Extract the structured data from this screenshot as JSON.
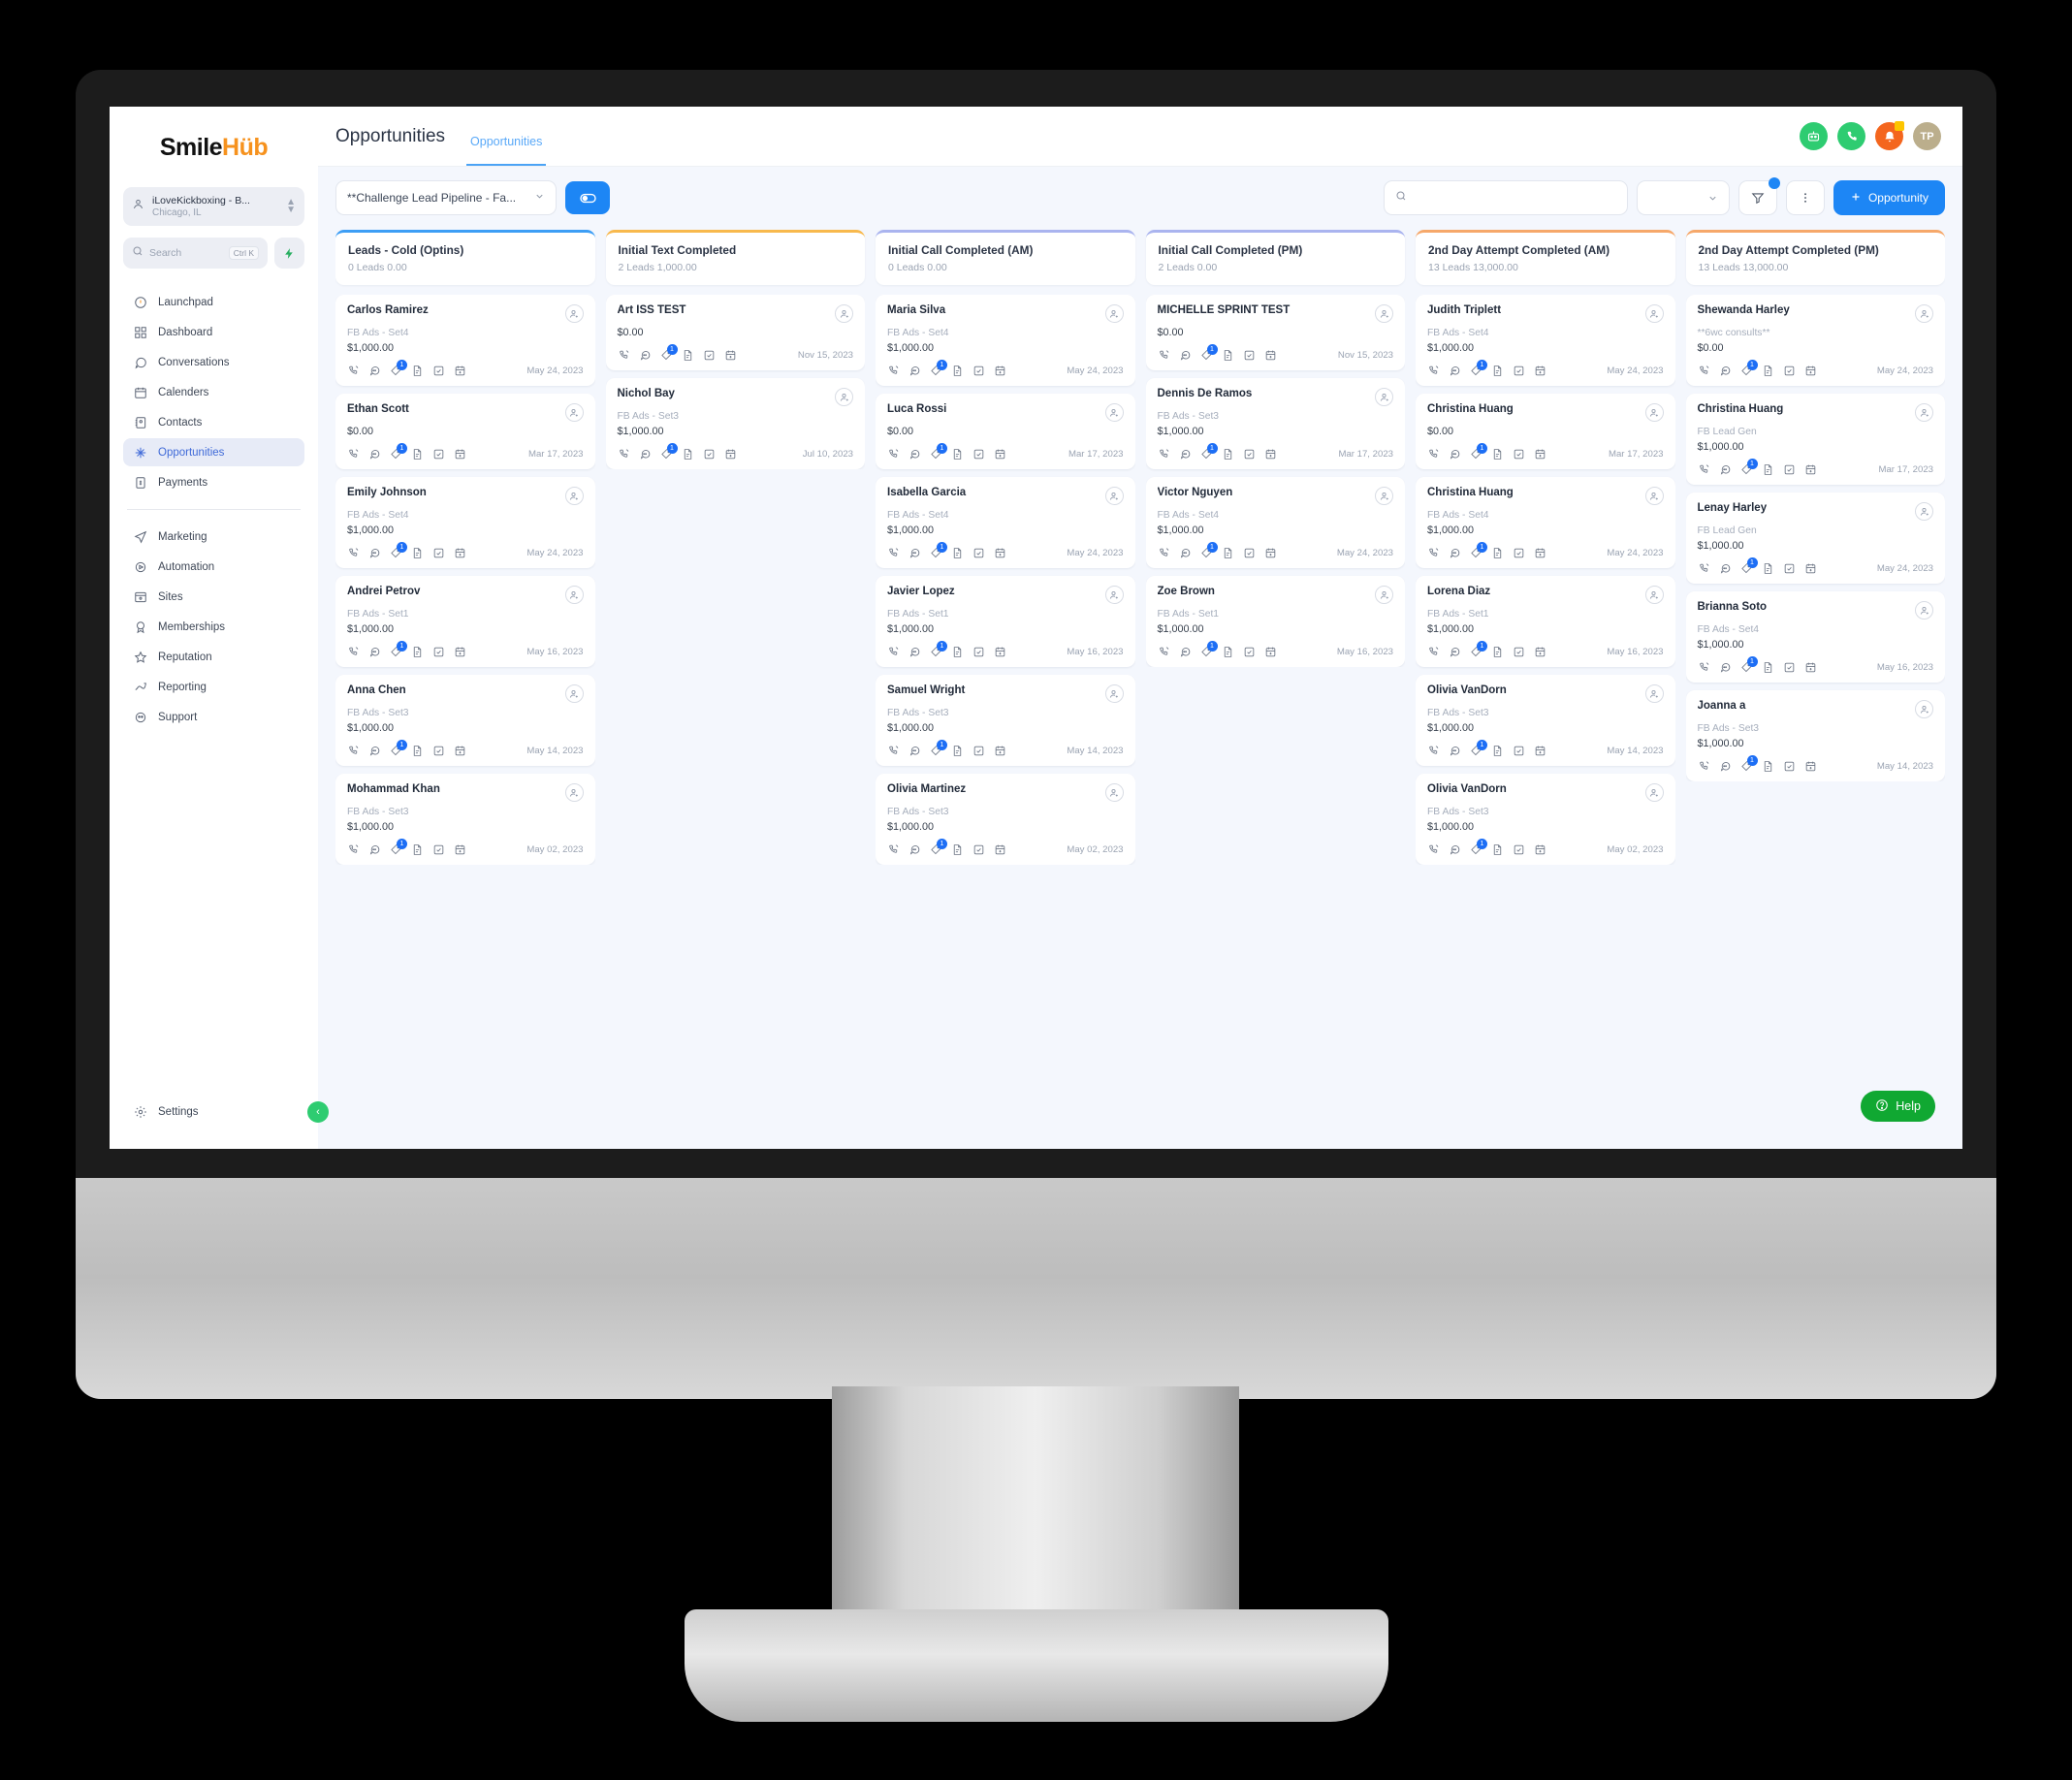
{
  "brand": {
    "name_part1": "Smile",
    "name_part2": "Hüb"
  },
  "sidebar": {
    "location": {
      "name": "iLoveKickboxing - B...",
      "sub": "Chicago, IL"
    },
    "search": {
      "placeholder": "Search",
      "shortcut": "Ctrl K"
    },
    "items": [
      {
        "label": "Launchpad",
        "icon": "rocket-icon"
      },
      {
        "label": "Dashboard",
        "icon": "grid-icon"
      },
      {
        "label": "Conversations",
        "icon": "chat-icon"
      },
      {
        "label": "Calenders",
        "icon": "calendar-icon"
      },
      {
        "label": "Contacts",
        "icon": "contacts-icon"
      },
      {
        "label": "Opportunities",
        "icon": "opportunities-icon"
      },
      {
        "label": "Payments",
        "icon": "payments-icon"
      }
    ],
    "items2": [
      {
        "label": "Marketing",
        "icon": "send-icon"
      },
      {
        "label": "Automation",
        "icon": "play-circle-icon"
      },
      {
        "label": "Sites",
        "icon": "window-icon"
      },
      {
        "label": "Memberships",
        "icon": "badge-icon"
      },
      {
        "label": "Reputation",
        "icon": "star-icon"
      },
      {
        "label": "Reporting",
        "icon": "trend-icon"
      },
      {
        "label": "Support",
        "icon": "support-icon"
      }
    ],
    "settings": {
      "label": "Settings",
      "icon": "gear-icon"
    }
  },
  "header": {
    "title": "Opportunities",
    "tab": "Opportunities",
    "avatar_initials": "TP"
  },
  "toolbar": {
    "pipeline": "**Challenge Lead Pipeline - Fa...",
    "search_placeholder": "",
    "add_label": "Opportunity"
  },
  "help": {
    "label": "Help"
  },
  "board": {
    "columns": [
      {
        "title": "Leads - Cold (Optins)",
        "meta": "0 Leads 0.00",
        "accent": "#3d9ef5",
        "cards": [
          {
            "name": "Carlos Ramirez",
            "source": "FB Ads - Set4",
            "amount": "$1,000.00",
            "date": "May 24, 2023",
            "badge": "1"
          },
          {
            "name": "Ethan Scott",
            "source": "",
            "amount": "$0.00",
            "date": "Mar 17, 2023",
            "badge": "1"
          },
          {
            "name": "Emily Johnson",
            "source": "FB Ads - Set4",
            "amount": "$1,000.00",
            "date": "May 24, 2023",
            "badge": "1"
          },
          {
            "name": "Andrei Petrov",
            "source": "FB Ads - Set1",
            "amount": "$1,000.00",
            "date": "May 16, 2023",
            "badge": "1"
          },
          {
            "name": "Anna Chen",
            "source": "FB Ads - Set3",
            "amount": "$1,000.00",
            "date": "May 14, 2023",
            "badge": "1"
          },
          {
            "name": "Mohammad Khan",
            "source": "FB Ads - Set3",
            "amount": "$1,000.00",
            "date": "May 02, 2023",
            "badge": "1"
          }
        ]
      },
      {
        "title": "Initial Text Completed",
        "meta": "2 Leads 1,000.00",
        "accent": "#f8b94d",
        "cards": [
          {
            "name": "Art ISS TEST",
            "source": "",
            "amount": "$0.00",
            "date": "Nov 15, 2023",
            "badge": "1"
          },
          {
            "name": "Nichol Bay",
            "source": "FB Ads - Set3",
            "amount": "$1,000.00",
            "date": "Jul 10, 2023",
            "badge": "1"
          }
        ]
      },
      {
        "title": "Initial Call Completed (AM)",
        "meta": "0 Leads 0.00",
        "accent": "#aab4ef",
        "cards": [
          {
            "name": "Maria Silva",
            "source": "FB Ads - Set4",
            "amount": "$1,000.00",
            "date": "May 24, 2023",
            "badge": "1"
          },
          {
            "name": "Luca Rossi",
            "source": "",
            "amount": "$0.00",
            "date": "Mar 17, 2023",
            "badge": "1"
          },
          {
            "name": "Isabella Garcia",
            "source": "FB Ads - Set4",
            "amount": "$1,000.00",
            "date": "May 24, 2023",
            "badge": "1"
          },
          {
            "name": "Javier Lopez",
            "source": "FB Ads - Set1",
            "amount": "$1,000.00",
            "date": "May 16, 2023",
            "badge": "1"
          },
          {
            "name": "Samuel Wright",
            "source": "FB Ads - Set3",
            "amount": "$1,000.00",
            "date": "May 14, 2023",
            "badge": "1"
          },
          {
            "name": "Olivia Martinez",
            "source": "FB Ads - Set3",
            "amount": "$1,000.00",
            "date": "May 02, 2023",
            "badge": "1"
          }
        ]
      },
      {
        "title": "Initial Call Completed (PM)",
        "meta": "2 Leads 0.00",
        "accent": "#aab4ef",
        "cards": [
          {
            "name": "MICHELLE SPRINT TEST",
            "source": "",
            "amount": "$0.00",
            "date": "Nov 15, 2023",
            "badge": "1"
          },
          {
            "name": "Dennis De Ramos",
            "source": "FB Ads - Set3",
            "amount": "$1,000.00",
            "date": "Mar 17, 2023",
            "badge": "1"
          },
          {
            "name": "Victor Nguyen",
            "source": "FB Ads - Set4",
            "amount": "$1,000.00",
            "date": "May 24, 2023",
            "badge": "1"
          },
          {
            "name": "Zoe Brown",
            "source": "FB Ads - Set1",
            "amount": "$1,000.00",
            "date": "May 16, 2023",
            "badge": "1"
          }
        ]
      },
      {
        "title": "2nd Day Attempt Completed (AM)",
        "meta": "13 Leads 13,000.00",
        "accent": "#f6a86a",
        "cards": [
          {
            "name": "Judith Triplett",
            "source": "FB Ads - Set4",
            "amount": "$1,000.00",
            "date": "May 24, 2023",
            "badge": "1"
          },
          {
            "name": "Christina Huang",
            "source": "",
            "amount": "$0.00",
            "date": "Mar 17, 2023",
            "badge": "1"
          },
          {
            "name": "Christina Huang",
            "source": "FB Ads - Set4",
            "amount": "$1,000.00",
            "date": "May 24, 2023",
            "badge": "1"
          },
          {
            "name": "Lorena Diaz",
            "source": "FB Ads - Set1",
            "amount": "$1,000.00",
            "date": "May 16, 2023",
            "badge": "1"
          },
          {
            "name": "Olivia VanDorn",
            "source": "FB Ads - Set3",
            "amount": "$1,000.00",
            "date": "May 14, 2023",
            "badge": "1"
          },
          {
            "name": "Olivia VanDorn",
            "source": "FB Ads - Set3",
            "amount": "$1,000.00",
            "date": "May 02, 2023",
            "badge": "1"
          }
        ]
      },
      {
        "title": "2nd Day Attempt Completed (PM)",
        "meta": "13 Leads 13,000.00",
        "accent": "#f6a86a",
        "cards": [
          {
            "name": "Shewanda Harley",
            "source": "**6wc consults**",
            "amount": "$0.00",
            "date": "May 24, 2023",
            "badge": "1"
          },
          {
            "name": "Christina Huang",
            "source": "FB Lead Gen",
            "amount": "$1,000.00",
            "date": "Mar 17, 2023",
            "badge": "1"
          },
          {
            "name": "Lenay Harley",
            "source": "FB Lead Gen",
            "amount": "$1,000.00",
            "date": "May 24, 2023",
            "badge": "1"
          },
          {
            "name": "Brianna Soto",
            "source": "FB Ads - Set4",
            "amount": "$1,000.00",
            "date": "May 16, 2023",
            "badge": "1"
          },
          {
            "name": "Joanna a",
            "source": "FB Ads - Set3",
            "amount": "$1,000.00",
            "date": "May 14, 2023",
            "badge": "1"
          }
        ]
      }
    ]
  }
}
